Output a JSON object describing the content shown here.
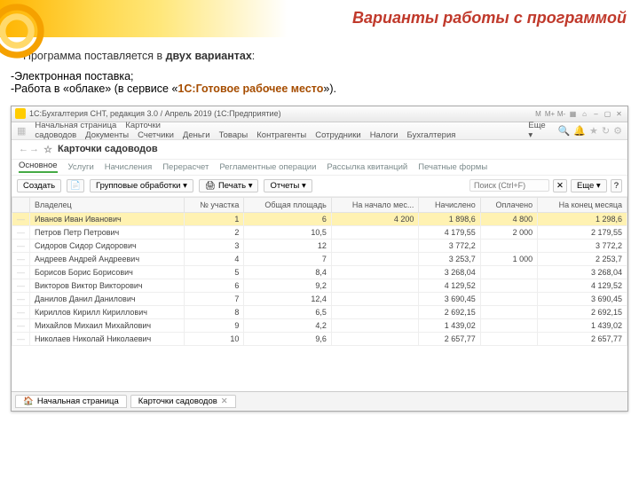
{
  "slide": {
    "title": "Варианты работы с программой",
    "intro_lead": "Программа поставляется в ",
    "intro_strong": "двух вариантах",
    "intro_tail": ":",
    "bullet1": "-Электронная поставка;",
    "bullet2_a": "-Работа в «облаке» (в сервисе «",
    "bullet2_link": "1С:Готовое рабочее место",
    "bullet2_b": "»)."
  },
  "titlebar": {
    "title": "1С:Бухгалтерия СНТ, редакция 3.0 / Апрель 2019 (1С:Предприятие)"
  },
  "menubar": {
    "items": [
      "Начальная страница",
      "Карточки садоводов",
      "Документы",
      "Счетчики",
      "Деньги",
      "Товары",
      "Контрагенты",
      "Сотрудники",
      "Налоги",
      "Бухгалтерия"
    ],
    "more": "Еще ▾"
  },
  "crumb": {
    "title": "Карточки садоводов"
  },
  "subtabs": {
    "items": [
      "Основное",
      "Услуги",
      "Начисления",
      "Перерасчет",
      "Регламентные операции",
      "Рассылка квитанций",
      "Печатные формы"
    ],
    "active_index": 0
  },
  "toolbar": {
    "create": "Создать",
    "group_ops": "Групповые обработки ▾",
    "print": "Печать ▾",
    "reports": "Отчеты ▾",
    "search_placeholder": "Поиск (Ctrl+F)",
    "more": "Еще ▾",
    "help": "?"
  },
  "table": {
    "headers": [
      "Владелец",
      "№ участка",
      "Общая площадь",
      "На начало мес...",
      "Начислено",
      "Оплачено",
      "На конец месяца"
    ],
    "rows": [
      {
        "owner": "Иванов Иван Иванович",
        "plot": "1",
        "area": "6",
        "start": "4 200",
        "charged": "1 898,6",
        "paid": "4 800",
        "end": "1 298,6",
        "sel": true
      },
      {
        "owner": "Петров Петр Петрович",
        "plot": "2",
        "area": "10,5",
        "start": "",
        "charged": "4 179,55",
        "paid": "2 000",
        "end": "2 179,55"
      },
      {
        "owner": "Сидоров Сидор Сидорович",
        "plot": "3",
        "area": "12",
        "start": "",
        "charged": "3 772,2",
        "paid": "",
        "end": "3 772,2"
      },
      {
        "owner": "Андреев Андрей Андреевич",
        "plot": "4",
        "area": "7",
        "start": "",
        "charged": "3 253,7",
        "paid": "1 000",
        "end": "2 253,7"
      },
      {
        "owner": "Борисов Борис Борисович",
        "plot": "5",
        "area": "8,4",
        "start": "",
        "charged": "3 268,04",
        "paid": "",
        "end": "3 268,04"
      },
      {
        "owner": "Викторов Виктор Викторович",
        "plot": "6",
        "area": "9,2",
        "start": "",
        "charged": "4 129,52",
        "paid": "",
        "end": "4 129,52"
      },
      {
        "owner": "Данилов Данил Данилович",
        "plot": "7",
        "area": "12,4",
        "start": "",
        "charged": "3 690,45",
        "paid": "",
        "end": "3 690,45"
      },
      {
        "owner": "Кириллов Кирилл Кириллович",
        "plot": "8",
        "area": "6,5",
        "start": "",
        "charged": "2 692,15",
        "paid": "",
        "end": "2 692,15"
      },
      {
        "owner": "Михайлов Михаил Михайлович",
        "plot": "9",
        "area": "4,2",
        "start": "",
        "charged": "1 439,02",
        "paid": "",
        "end": "1 439,02"
      },
      {
        "owner": "Николаев Николай Николаевич",
        "plot": "10",
        "area": "9,6",
        "start": "",
        "charged": "2 657,77",
        "paid": "",
        "end": "2 657,77"
      }
    ]
  },
  "bottom": {
    "tab1": "Начальная страница",
    "tab2": "Карточки садоводов"
  }
}
